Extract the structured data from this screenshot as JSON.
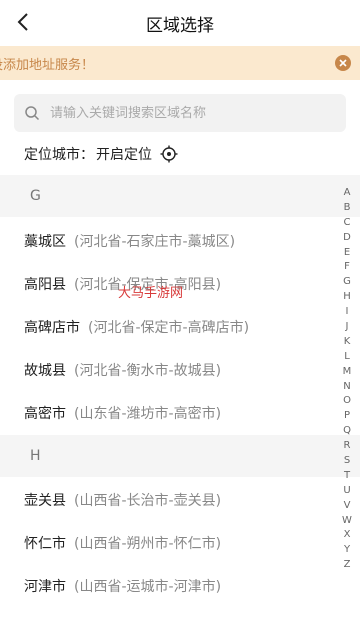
{
  "header": {
    "title": "区域选择"
  },
  "notice": {
    "text": "没添加地址服务！"
  },
  "search": {
    "placeholder": "请输入关键词搜索区域名称"
  },
  "location": {
    "label": "定位城市：",
    "action": "开启定位"
  },
  "sections": [
    {
      "letter": "G",
      "items": [
        {
          "name": "藁城区",
          "path": "(河北省-石家庄市-藁城区)"
        },
        {
          "name": "高阳县",
          "path": "(河北省-保定市-高阳县)"
        },
        {
          "name": "高碑店市",
          "path": "(河北省-保定市-高碑店市)"
        },
        {
          "name": "故城县",
          "path": "(河北省-衡水市-故城县)"
        },
        {
          "name": "高密市",
          "path": "(山东省-潍坊市-高密市)"
        }
      ]
    },
    {
      "letter": "H",
      "items": [
        {
          "name": "壶关县",
          "path": "(山西省-长治市-壶关县)"
        },
        {
          "name": "怀仁市",
          "path": "(山西省-朔州市-怀仁市)"
        },
        {
          "name": "河津市",
          "path": "(山西省-运城市-河津市)"
        }
      ]
    }
  ],
  "index_letters": [
    "A",
    "B",
    "C",
    "D",
    "E",
    "F",
    "G",
    "H",
    "I",
    "J",
    "K",
    "L",
    "M",
    "N",
    "O",
    "P",
    "Q",
    "R",
    "S",
    "T",
    "U",
    "V",
    "W",
    "X",
    "Y",
    "Z"
  ],
  "watermark": "大马手游网",
  "colors": {
    "notice_bg": "#fbe9cf",
    "notice_text": "#c7874a",
    "section_bg": "#f5f5f5"
  }
}
